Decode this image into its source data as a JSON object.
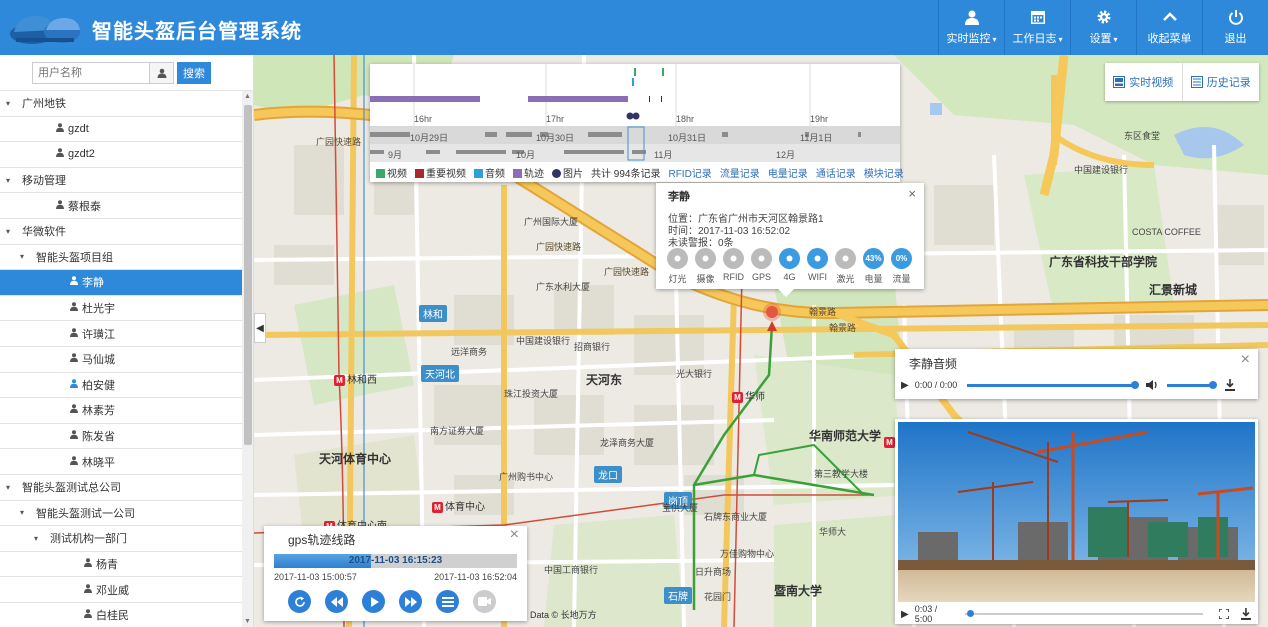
{
  "header": {
    "title": "智能头盔后台管理系统",
    "nav": [
      {
        "label": "实时监控",
        "caret": "▾",
        "icon": "monitor-person-icon"
      },
      {
        "label": "工作日志",
        "caret": "▾",
        "icon": "calendar-icon"
      },
      {
        "label": "设置",
        "caret": "▾",
        "icon": "gear-icon"
      },
      {
        "label": "收起菜单",
        "caret": "",
        "icon": "chevron-up-icon"
      },
      {
        "label": "退出",
        "caret": "",
        "icon": "power-icon"
      }
    ]
  },
  "sidebar": {
    "search_placeholder": "用户名称",
    "search_button": "搜索",
    "tree": [
      {
        "label": "广州地铁",
        "level": 0,
        "type": "group",
        "expanded": true
      },
      {
        "label": "gzdt",
        "level": 1,
        "type": "user"
      },
      {
        "label": "gzdt2",
        "level": 1,
        "type": "user"
      },
      {
        "label": "移动管理",
        "level": 0,
        "type": "group",
        "expanded": true
      },
      {
        "label": "蔡根泰",
        "level": 1,
        "type": "user"
      },
      {
        "label": "华微软件",
        "level": 0,
        "type": "group",
        "expanded": true
      },
      {
        "label": "智能头盔项目组",
        "level": 1,
        "type": "group",
        "expanded": true
      },
      {
        "label": "李静",
        "level": 2,
        "type": "user",
        "active": true
      },
      {
        "label": "杜光宇",
        "level": 2,
        "type": "user"
      },
      {
        "label": "许璜江",
        "level": 2,
        "type": "user"
      },
      {
        "label": "马仙城",
        "level": 2,
        "type": "user"
      },
      {
        "label": "柏安健",
        "level": 2,
        "type": "user",
        "online": true
      },
      {
        "label": "林素芳",
        "level": 2,
        "type": "user"
      },
      {
        "label": "陈发省",
        "level": 2,
        "type": "user"
      },
      {
        "label": "林晓平",
        "level": 2,
        "type": "user"
      },
      {
        "label": "智能头盔测试总公司",
        "level": 0,
        "type": "group",
        "expanded": true
      },
      {
        "label": "智能头盔测试一公司",
        "level": 1,
        "type": "group",
        "expanded": true
      },
      {
        "label": "测试机构一部门",
        "level": 2,
        "type": "group",
        "expanded": true
      },
      {
        "label": "杨青",
        "level": 3,
        "type": "user"
      },
      {
        "label": "邓业威",
        "level": 3,
        "type": "user"
      },
      {
        "label": "白桂民",
        "level": 3,
        "type": "user"
      }
    ]
  },
  "timeline": {
    "hours": [
      "16hr",
      "17hr",
      "18hr",
      "19hr"
    ],
    "days": [
      "10月29日",
      "10月30日",
      "10月31日",
      "11月1日"
    ],
    "months": [
      "9月",
      "10月",
      "11月",
      "12月"
    ],
    "legend": [
      {
        "label": "视频",
        "color": "#3aa76d"
      },
      {
        "label": "重要视频",
        "color": "#a9282c"
      },
      {
        "label": "音频",
        "color": "#2da0dc"
      },
      {
        "label": "轨迹",
        "color": "#8a6fb6"
      }
    ],
    "photo_label": "图片",
    "total_text": "共计 994条记录",
    "links": [
      "RFID记录",
      "流量记录",
      "电量记录",
      "通话记录",
      "模块记录"
    ]
  },
  "infowindow": {
    "title": "李静",
    "close": "×",
    "location": "位置：广东省广州市天河区翰景路1",
    "time": "时间：2017-11-03 16:52:02",
    "unread_alarm": "未读警报：0条",
    "icons": [
      {
        "label": "灯光",
        "name": "flashlight-icon",
        "on": false,
        "text": ""
      },
      {
        "label": "摄像",
        "name": "camera-icon",
        "on": false,
        "text": ""
      },
      {
        "label": "RFID",
        "name": "flag-icon",
        "on": false,
        "text": ""
      },
      {
        "label": "GPS",
        "name": "location-pin-icon",
        "on": false,
        "text": ""
      },
      {
        "label": "4G",
        "name": "signal-icon",
        "on": true,
        "text": ""
      },
      {
        "label": "WIFI",
        "name": "wifi-icon",
        "on": true,
        "text": ""
      },
      {
        "label": "激光",
        "name": "laser-icon",
        "on": false,
        "text": ""
      },
      {
        "label": "电量",
        "name": "battery-icon",
        "on": true,
        "text": "43%"
      },
      {
        "label": "流量",
        "name": "data-icon",
        "on": true,
        "text": "0%"
      }
    ]
  },
  "map_buttons": {
    "live_video": "实时视频",
    "history": "历史记录"
  },
  "audio": {
    "title": "李静音频",
    "time": "0:00 / 0:00",
    "close": "×"
  },
  "video": {
    "time": "0:03 / 5:00",
    "progress": 0.01
  },
  "gps": {
    "title": "gps轨迹线路",
    "current_time": "2017-11-03 16:15:23",
    "start_time": "2017-11-03 15:00:57",
    "end_time": "2017-11-03 16:52:04",
    "progress": 0.4,
    "close": "×",
    "buttons": [
      "refresh-button",
      "rewind-button",
      "play-button",
      "fast-forward-button",
      "list-button",
      "camera-button"
    ]
  },
  "map": {
    "attribution": "Data © 长地万方",
    "districts": [
      "林和",
      "天河北",
      "天河东",
      "天河体育中心",
      "华南师范大学",
      "暨南大学",
      "龙口",
      "岗顶",
      "石牌",
      "广东省科技干部学院",
      "汇景新城"
    ],
    "roads": [
      "广园快速路",
      "广园快速路",
      "广园快速路",
      "翰景路",
      "翰景路"
    ],
    "metro_stations": [
      "林和西",
      "华师",
      "体育中心",
      "体育中心南",
      "石牌桥"
    ],
    "pois": [
      "广州国际大厦",
      "中国建设银行",
      "远洋商务",
      "招商银行",
      "珠江投资大厦",
      "广东水利大厦",
      "光大银行",
      "南方证券大厦",
      "龙泽商务大厦",
      "广州购书中心",
      "万佳购物中心",
      "日升商场",
      "石牌东商业大厦",
      "宝供大厦",
      "中国工商银行",
      "花园门",
      "第三教学大楼",
      "中国建设银行",
      "COSTA COFFEE",
      "东区食堂",
      "华师大"
    ]
  }
}
